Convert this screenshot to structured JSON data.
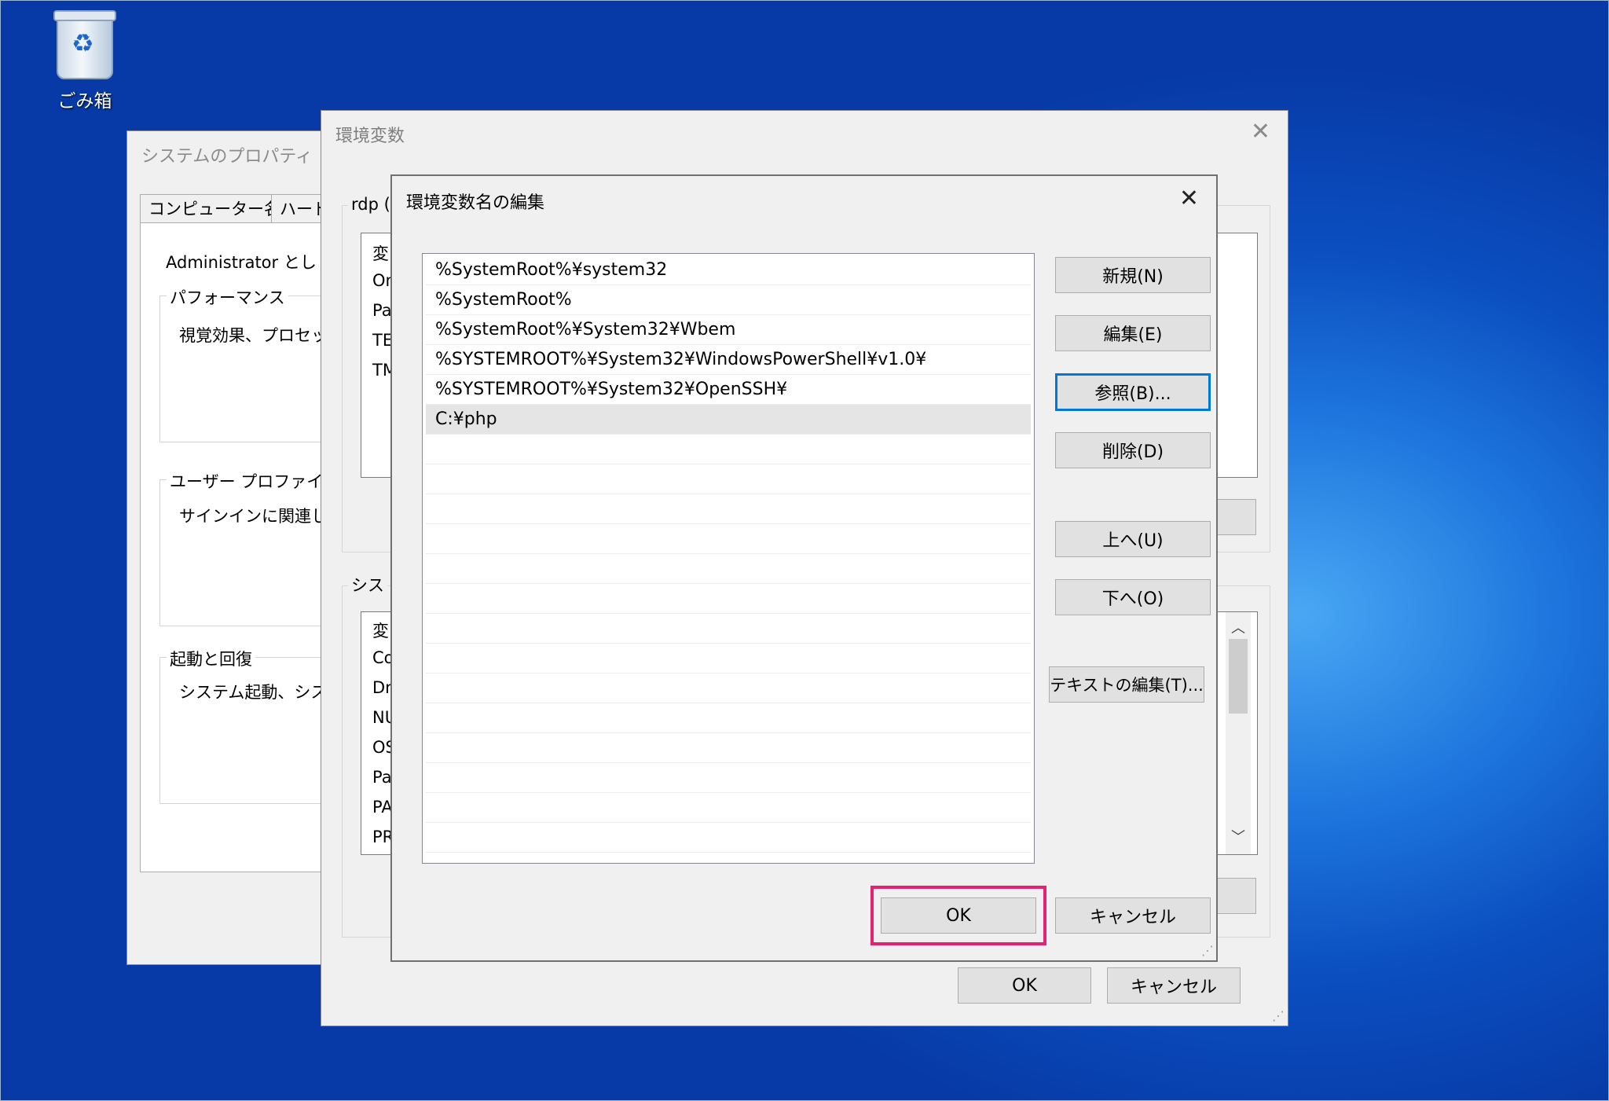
{
  "desktop": {
    "recycle_bin_label": "ごみ箱"
  },
  "system_properties": {
    "title": "システムのプロパティ",
    "tabs": [
      "コンピューター名",
      "ハード"
    ],
    "admin_text": "Administrator とし",
    "performance": {
      "legend": "パフォーマンス",
      "text": "視覚効果、プロセッ"
    },
    "user_profile": {
      "legend": "ユーザー プロファイル",
      "text": "サインインに関連し"
    },
    "startup": {
      "legend": "起動と回復",
      "text": "システム起動、シス"
    }
  },
  "env_vars": {
    "title": "環境変数",
    "user_group_label": "rdp (",
    "user_list_fragments": [
      "変",
      "On",
      "Pa",
      "TE",
      "TM"
    ],
    "system_group_label": "シス",
    "system_list_fragments": [
      "変",
      "Co",
      "Dr",
      "NU",
      "OS",
      "Pa",
      "PA",
      "PR"
    ],
    "ok_label": "OK",
    "cancel_label": "キャンセル"
  },
  "edit_dialog": {
    "title": "環境変数名の編集",
    "paths": [
      "%SystemRoot%¥system32",
      "%SystemRoot%",
      "%SystemRoot%¥System32¥Wbem",
      "%SYSTEMROOT%¥System32¥WindowsPowerShell¥v1.0¥",
      "%SYSTEMROOT%¥System32¥OpenSSH¥",
      "C:¥php"
    ],
    "selected_index": 5,
    "buttons": {
      "new": "新規(N)",
      "edit": "編集(E)",
      "browse": "参照(B)...",
      "delete": "削除(D)",
      "move_up": "上へ(U)",
      "move_down": "下へ(O)",
      "edit_text": "テキストの編集(T)...",
      "ok": "OK",
      "cancel": "キャンセル"
    },
    "highlight_color": "#e5226f"
  },
  "icons": {
    "close": "close-icon",
    "recycle_bin": "recycle-bin-icon",
    "scroll_up": "chevron-up-icon",
    "scroll_down": "chevron-down-icon",
    "resize_grip": "resize-grip-icon"
  }
}
